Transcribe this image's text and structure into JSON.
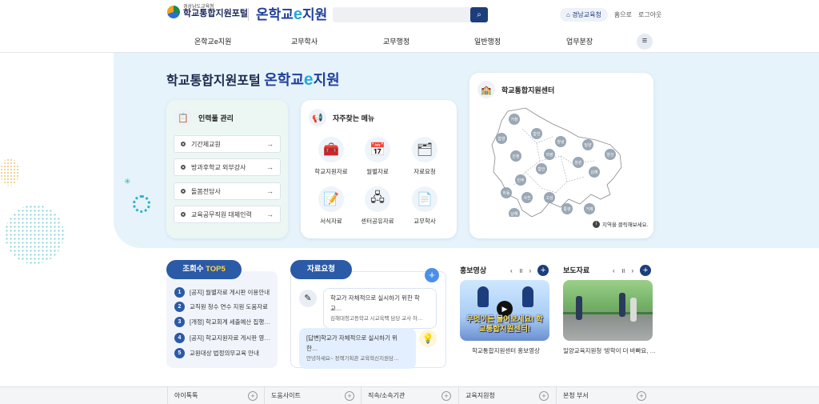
{
  "header": {
    "logo_small": "경상남도교육청",
    "logo_big": "학교통합지원포털",
    "brand_prefix": "온학교",
    "brand_e": "e",
    "brand_suffix": "지원",
    "search_placeholder": "",
    "office_badge": "경남교육청",
    "login_link": "홈으로",
    "logout_link": "로그아웃"
  },
  "nav": {
    "items": [
      "온학교e지원",
      "교무학사",
      "교무행정",
      "일반행정",
      "업무분장"
    ]
  },
  "hero": {
    "title_prefix": "학교통합지원포털",
    "brand_prefix": "온학교",
    "brand_e": "e",
    "brand_suffix": "지원"
  },
  "personnel": {
    "title": "인력풀 관리",
    "items": [
      "기간제교원",
      "방과후학교 외부강사",
      "돌봄전담사",
      "교육공무직원 대체인력"
    ]
  },
  "favorites": {
    "title": "자주찾는 메뉴",
    "items": [
      {
        "label": "학교지원자료",
        "icon": "toolbox-icon"
      },
      {
        "label": "월별자료",
        "icon": "calendar-icon"
      },
      {
        "label": "자료요청",
        "icon": "document-request-icon"
      },
      {
        "label": "서식자료",
        "icon": "form-icon"
      },
      {
        "label": "센터공유자료",
        "icon": "share-icon"
      },
      {
        "label": "교무학사",
        "icon": "academic-icon"
      }
    ]
  },
  "center": {
    "title": "학교통합지원센터",
    "regions": [
      "거창",
      "함양",
      "합천",
      "창녕",
      "밀양",
      "양산",
      "산청",
      "의령",
      "함안",
      "창원",
      "김해",
      "진주",
      "하동",
      "사천",
      "고성",
      "남해",
      "통영",
      "거제"
    ],
    "note": "지역을 클릭해보세요."
  },
  "top5": {
    "title_prefix": "조회수 ",
    "title_highlight": "TOP5",
    "items": [
      {
        "rank": "1",
        "text": "[공지] 월별자료 게시판 이용안내"
      },
      {
        "rank": "2",
        "text": "교직원 청수 연수 지원 도움자료"
      },
      {
        "rank": "3",
        "text": "[개정] 학교회계 세출예산 집행…"
      },
      {
        "rank": "4",
        "text": "[공지] 학교지원자료 게시판 영…"
      },
      {
        "rank": "5",
        "text": "교원대상 법정의무교육 안내"
      }
    ]
  },
  "requests": {
    "title": "자료요청",
    "q_title": "학교가 자체적으로 실시하기 위한 학교…",
    "q_sub": "김해대청고등학교 시교육팩 담당 교사 하…",
    "a_title": "[답변]학교가 자체적으로 실시하기 위한…",
    "a_sub": "안녕하세요~ 정책기획관 교육혁신지원담…"
  },
  "promo_video": {
    "title": "홍보영상",
    "controls": [
      "‹",
      "॥",
      "›"
    ],
    "overlay": "무엇이든 물어보세요! 학교통합지원센터!",
    "caption": "학교통합지원센터 홍보영상"
  },
  "press": {
    "title": "보도자료",
    "controls": [
      "‹",
      "॥",
      "›"
    ],
    "caption": "일양교육지원청 '방학이 더 바빠요, …"
  },
  "footer": {
    "items": [
      "아이톡톡",
      "도움사이트",
      "직속/소속기관",
      "교육지원청",
      "본청 부서"
    ]
  },
  "colors": {
    "brand_navy": "#1d3e7c",
    "pill_blue": "#2b5aa6",
    "hero_bg": "#e6f3fb",
    "accent_yellow": "#ffd44a"
  }
}
